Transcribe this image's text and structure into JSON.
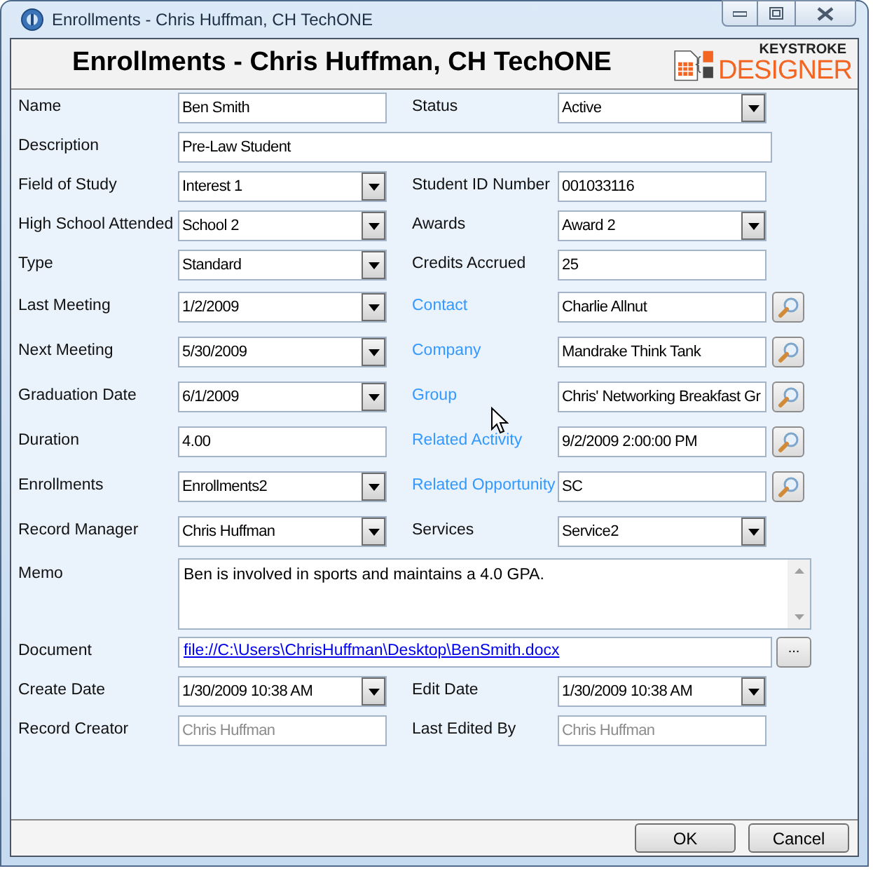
{
  "window": {
    "title": "Enrollments - Chris Huffman, CH TechONE"
  },
  "header": {
    "title": "Enrollments - Chris Huffman, CH TechONE",
    "logo_top": "KEYSTROKE",
    "logo_bottom": "DESIGNER"
  },
  "rows": [
    {
      "fields": [
        {
          "label": "Name",
          "linked": false,
          "kind": "text",
          "value": "Ben Smith"
        },
        {
          "label": "Status",
          "linked": false,
          "kind": "combo",
          "value": "Active"
        }
      ]
    },
    {
      "fields": [
        {
          "label": "Description",
          "linked": false,
          "kind": "wide",
          "value": "Pre-Law Student"
        }
      ]
    },
    {
      "fields": [
        {
          "label": "Field of Study",
          "linked": false,
          "kind": "combo",
          "value": "Interest 1"
        },
        {
          "label": "Student ID Number",
          "linked": false,
          "kind": "text",
          "value": "001033116"
        }
      ]
    },
    {
      "fields": [
        {
          "label": "High School Attended",
          "linked": false,
          "kind": "combo",
          "value": "School 2"
        },
        {
          "label": "Awards",
          "linked": false,
          "kind": "combo",
          "value": "Award 2"
        }
      ]
    },
    {
      "fields": [
        {
          "label": "Type",
          "linked": false,
          "kind": "combo",
          "value": "Standard"
        },
        {
          "label": "Credits Accrued",
          "linked": false,
          "kind": "text",
          "value": "25"
        }
      ]
    },
    {
      "fields": [
        {
          "label": "Last Meeting",
          "linked": false,
          "kind": "combo",
          "value": "1/2/2009"
        },
        {
          "label": "Contact",
          "linked": true,
          "kind": "lookup",
          "value": "Charlie Allnut"
        }
      ]
    },
    {
      "fields": [
        {
          "label": "Next Meeting",
          "linked": false,
          "kind": "combo",
          "value": "5/30/2009"
        },
        {
          "label": "Company",
          "linked": true,
          "kind": "lookup",
          "value": "Mandrake Think Tank"
        }
      ]
    },
    {
      "fields": [
        {
          "label": "Graduation Date",
          "linked": false,
          "kind": "combo",
          "value": "6/1/2009"
        },
        {
          "label": "Group",
          "linked": true,
          "kind": "lookup",
          "value": "Chris' Networking Breakfast Gr"
        }
      ]
    },
    {
      "fields": [
        {
          "label": "Duration",
          "linked": false,
          "kind": "text",
          "value": "4.00"
        },
        {
          "label": "Related Activity",
          "linked": true,
          "kind": "lookup",
          "value": "9/2/2009 2:00:00 PM"
        }
      ]
    },
    {
      "fields": [
        {
          "label": "Enrollments",
          "linked": false,
          "kind": "combo",
          "value": "Enrollments2"
        },
        {
          "label": "Related Opportunity",
          "linked": true,
          "kind": "lookup",
          "value": "SC"
        }
      ]
    },
    {
      "fields": [
        {
          "label": "Record Manager",
          "linked": false,
          "kind": "combo",
          "value": "Chris Huffman"
        },
        {
          "label": "Services",
          "linked": false,
          "kind": "combo",
          "value": "Service2"
        }
      ]
    },
    {
      "fields": [
        {
          "label": "Memo",
          "linked": false,
          "kind": "memo",
          "value": "Ben is involved in sports and maintains a 4.0 GPA."
        }
      ]
    },
    {
      "fields": [
        {
          "label": "Document",
          "linked": false,
          "kind": "file",
          "value": "file://C:\\Users\\ChrisHuffman\\Desktop\\BenSmith.docx",
          "button": "..."
        }
      ]
    },
    {
      "fields": [
        {
          "label": "Create Date",
          "linked": false,
          "kind": "combo",
          "value": "1/30/2009 10:38 AM"
        },
        {
          "label": "Edit Date",
          "linked": false,
          "kind": "combo",
          "value": "1/30/2009 10:38 AM"
        }
      ]
    },
    {
      "fields": [
        {
          "label": "Record Creator",
          "linked": false,
          "kind": "readonly",
          "value": "Chris Huffman"
        },
        {
          "label": "Last Edited By",
          "linked": false,
          "kind": "readonly",
          "value": "Chris Huffman"
        }
      ]
    }
  ],
  "buttons": [
    {
      "label": "OK"
    },
    {
      "label": "Cancel"
    }
  ]
}
